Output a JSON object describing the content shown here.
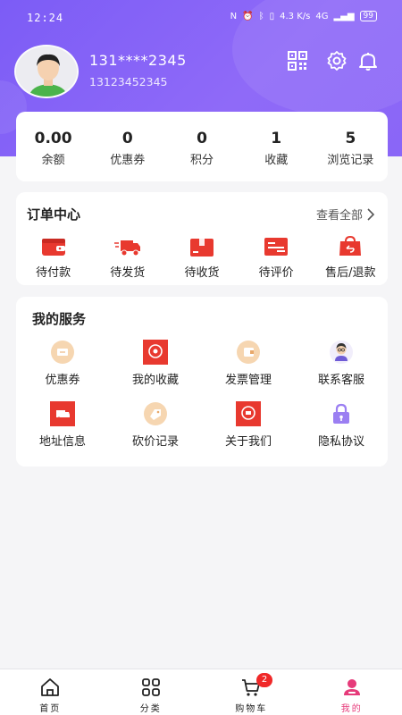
{
  "status_bar": {
    "time": "12:24",
    "network": "4.3 K/s",
    "signal": "4G",
    "battery": "99"
  },
  "profile": {
    "username": "131****2345",
    "phone": "13123452345"
  },
  "header_icons": [
    "qr-code-icon",
    "settings-icon",
    "notification-bell-icon"
  ],
  "stats": [
    {
      "value": "0.00",
      "label": "余额"
    },
    {
      "value": "0",
      "label": "优惠券"
    },
    {
      "value": "0",
      "label": "积分"
    },
    {
      "value": "1",
      "label": "收藏"
    },
    {
      "value": "5",
      "label": "浏览记录"
    }
  ],
  "orders": {
    "title": "订单中心",
    "see_all": "查看全部",
    "items": [
      {
        "label": "待付款",
        "icon": "wallet-icon"
      },
      {
        "label": "待发货",
        "icon": "truck-icon"
      },
      {
        "label": "待收货",
        "icon": "box-icon"
      },
      {
        "label": "待评价",
        "icon": "review-icon"
      },
      {
        "label": "售后/退款",
        "icon": "refund-icon"
      }
    ]
  },
  "services": {
    "title": "我的服务",
    "items": [
      {
        "label": "优惠券",
        "icon": "coupon-icon"
      },
      {
        "label": "我的收藏",
        "icon": "favorites-icon"
      },
      {
        "label": "发票管理",
        "icon": "invoice-icon"
      },
      {
        "label": "联系客服",
        "icon": "customer-service-icon"
      },
      {
        "label": "地址信息",
        "icon": "address-icon"
      },
      {
        "label": "砍价记录",
        "icon": "bargain-icon"
      },
      {
        "label": "关于我们",
        "icon": "about-icon"
      },
      {
        "label": "隐私协议",
        "icon": "privacy-lock-icon"
      }
    ]
  },
  "tabbar": {
    "items": [
      {
        "label": "首页",
        "icon": "home-icon"
      },
      {
        "label": "分类",
        "icon": "category-grid-icon"
      },
      {
        "label": "购物车",
        "icon": "cart-icon",
        "badge": "2"
      },
      {
        "label": "我的",
        "icon": "profile-icon",
        "active": true
      }
    ]
  },
  "colors": {
    "header": "#7c5cf6",
    "accent_red": "#e8392f",
    "active_tab": "#e63b7a"
  }
}
